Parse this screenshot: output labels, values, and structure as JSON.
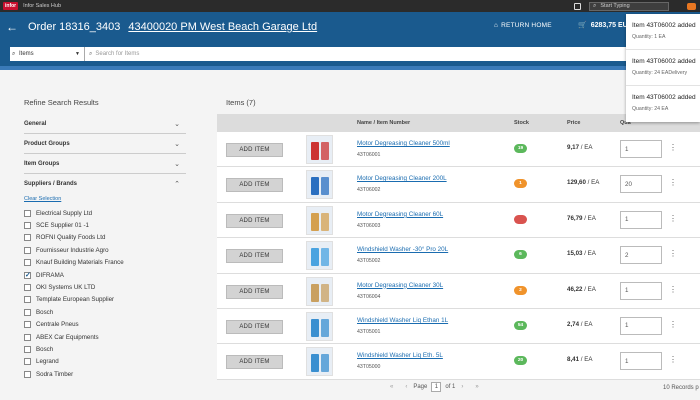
{
  "topbar": {
    "logo": "infor",
    "app_name": "Infor Sales Hub",
    "search_placeholder": "Start Typing"
  },
  "header": {
    "order": "Order 18316_3403",
    "customer": "43400020 PM West Beach Garage Ltd",
    "return_home": "RETURN HOME",
    "cart_total": "6283,75 EUR"
  },
  "search": {
    "scope": "Items",
    "placeholder": "Search for Items"
  },
  "sidebar": {
    "title": "Refine Search Results",
    "facets": [
      "General",
      "Product Groups",
      "Item Groups",
      "Suppliers / Brands"
    ],
    "clear_selection": "Clear Selection",
    "brands": [
      {
        "label": "Electrical Supply Ltd",
        "checked": false
      },
      {
        "label": "SCE Supplier 01 -1",
        "checked": false
      },
      {
        "label": "ROFNI Quality Foods Ltd",
        "checked": false
      },
      {
        "label": "Fournisseur Industrie Agro",
        "checked": false
      },
      {
        "label": "Knauf Building Materials France",
        "checked": false
      },
      {
        "label": "DIFRAMA",
        "checked": true
      },
      {
        "label": "OKI Systems UK LTD",
        "checked": false
      },
      {
        "label": "Template European Supplier",
        "checked": false
      },
      {
        "label": "Bosch",
        "checked": false
      },
      {
        "label": "Centrale Pneus",
        "checked": false
      },
      {
        "label": "ABEX Car Equipments",
        "checked": false
      },
      {
        "label": "Bosch",
        "checked": false
      },
      {
        "label": "Legrand",
        "checked": false
      },
      {
        "label": "Sodra Timber",
        "checked": false
      }
    ]
  },
  "items": {
    "title": "Items (7)",
    "columns": {
      "name": "Name / Item Number",
      "stock": "Stock",
      "price": "Price",
      "quantity": "Qua"
    },
    "add_label": "ADD ITEM",
    "rows": [
      {
        "name": "Motor Degreasing Cleaner 500ml",
        "number": "43T06001",
        "stock": "19",
        "stock_color": "#5cb85c",
        "price": "9,17",
        "unit": "/ EA",
        "qty": "1"
      },
      {
        "name": "Motor Degreasing Cleaner 200L",
        "number": "43T06002",
        "stock": "1",
        "stock_color": "#f0932b",
        "price": "129,60",
        "unit": "/ EA",
        "qty": "20"
      },
      {
        "name": "Motor Degreasing Cleaner 60L",
        "number": "43T06003",
        "stock": "",
        "stock_color": "#d9534f",
        "price": "76,79",
        "unit": "/ EA",
        "qty": "1"
      },
      {
        "name": "Windshield Washer -30° Pro 20L",
        "number": "43T05002",
        "stock": "6",
        "stock_color": "#5cb85c",
        "price": "15,03",
        "unit": "/ EA",
        "qty": "2"
      },
      {
        "name": "Motor Degreasing Cleaner 30L",
        "number": "43T06004",
        "stock": "2",
        "stock_color": "#f0932b",
        "price": "46,22",
        "unit": "/ EA",
        "qty": "1"
      },
      {
        "name": "Windshield Washer Liq Ethan 1L",
        "number": "43T05001",
        "stock": "54",
        "stock_color": "#5cb85c",
        "price": "2,74",
        "unit": "/ EA",
        "qty": "1"
      },
      {
        "name": "Windshield Washer Liq Eth. 5L",
        "number": "43T05000",
        "stock": "20",
        "stock_color": "#5cb85c",
        "price": "8,41",
        "unit": "/ EA",
        "qty": "1"
      }
    ]
  },
  "pager": {
    "label": "Page",
    "current": "1",
    "of": "of 1",
    "records": "10 Records p"
  },
  "toasts": [
    {
      "title": "Item 43T06002 added",
      "detail": "Quantity: 1 EA"
    },
    {
      "title": "Item 43T06002 added",
      "detail": "Quantity: 24 EADelivery"
    },
    {
      "title": "Item 43T06002 added",
      "detail": "Quantity: 24 EA"
    }
  ]
}
